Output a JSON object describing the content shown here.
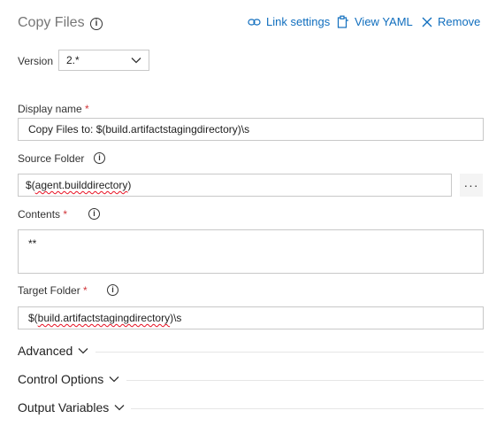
{
  "header": {
    "title": "Copy Files",
    "link_settings": "Link settings",
    "view_yaml": "View YAML",
    "remove": "Remove"
  },
  "version": {
    "label": "Version",
    "value": "2.*"
  },
  "display_name": {
    "label": "Display name",
    "required": "*",
    "value": "Copy Files to: $(build.artifactstagingdirectory)\\s"
  },
  "source_folder": {
    "label": "Source Folder",
    "value_prefix": "$(",
    "value_misspelled": "agent.builddirectory",
    "value_suffix": ")",
    "browse": "···"
  },
  "contents": {
    "label": "Contents",
    "required": "*",
    "value": "**"
  },
  "target_folder": {
    "label": "Target Folder",
    "required": "*",
    "value_prefix": "$(",
    "value_misspelled": "build.artifactstagingdirectory",
    "value_suffix": ")\\s"
  },
  "sections": {
    "advanced": "Advanced",
    "control_options": "Control Options",
    "output_variables": "Output Variables"
  },
  "icons": {
    "info": "info-icon",
    "link": "link-icon",
    "yaml": "clipboard-icon",
    "remove": "close-icon",
    "chevron": "chevron-down-icon"
  },
  "colors": {
    "link": "#106ebe",
    "required": "#d13438",
    "border": "#c8c8c8",
    "title": "#767676"
  }
}
